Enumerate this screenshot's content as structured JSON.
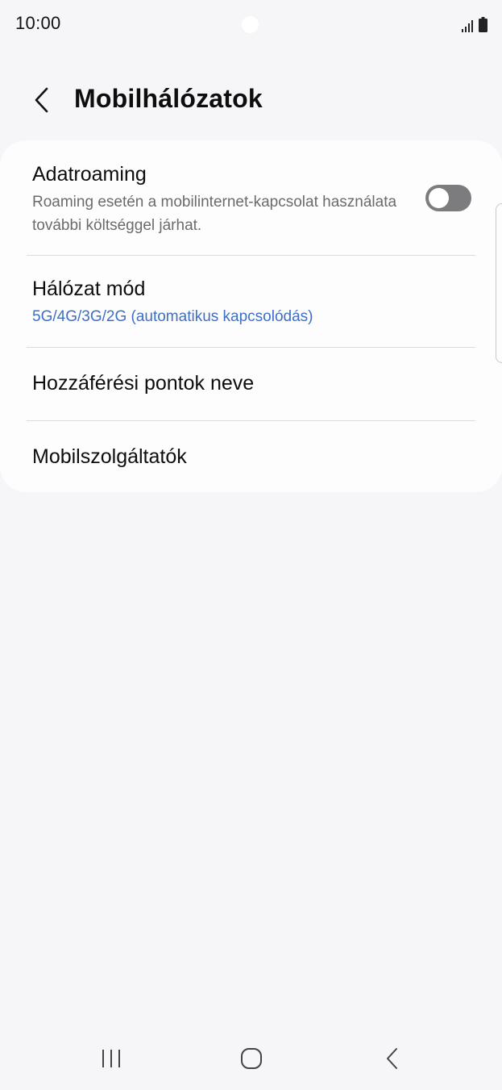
{
  "status_bar": {
    "time": "10:00",
    "icons": [
      "signal-icon",
      "battery-icon"
    ]
  },
  "header": {
    "title": "Mobilhálózatok",
    "back_icon": "chevron-left-icon"
  },
  "settings": {
    "data_roaming": {
      "title": "Adatroaming",
      "description": "Roaming esetén a mobilinternet-kapcsolat használata további költséggel járhat.",
      "enabled": false
    },
    "network_mode": {
      "title": "Hálózat mód",
      "value": "5G/4G/3G/2G (automatikus kapcsolódás)"
    },
    "access_point_names": {
      "title": "Hozzáférési pontok neve"
    },
    "network_operators": {
      "title": "Mobilszolgáltatók"
    }
  },
  "nav_bar": {
    "buttons": [
      "recent-apps-icon",
      "home-icon",
      "back-icon"
    ]
  },
  "colors": {
    "background": "#f6f6f8",
    "card": "#fdfdfe",
    "accent_blue": "#3d6fc4",
    "toggle_off": "#7c7c7f"
  }
}
